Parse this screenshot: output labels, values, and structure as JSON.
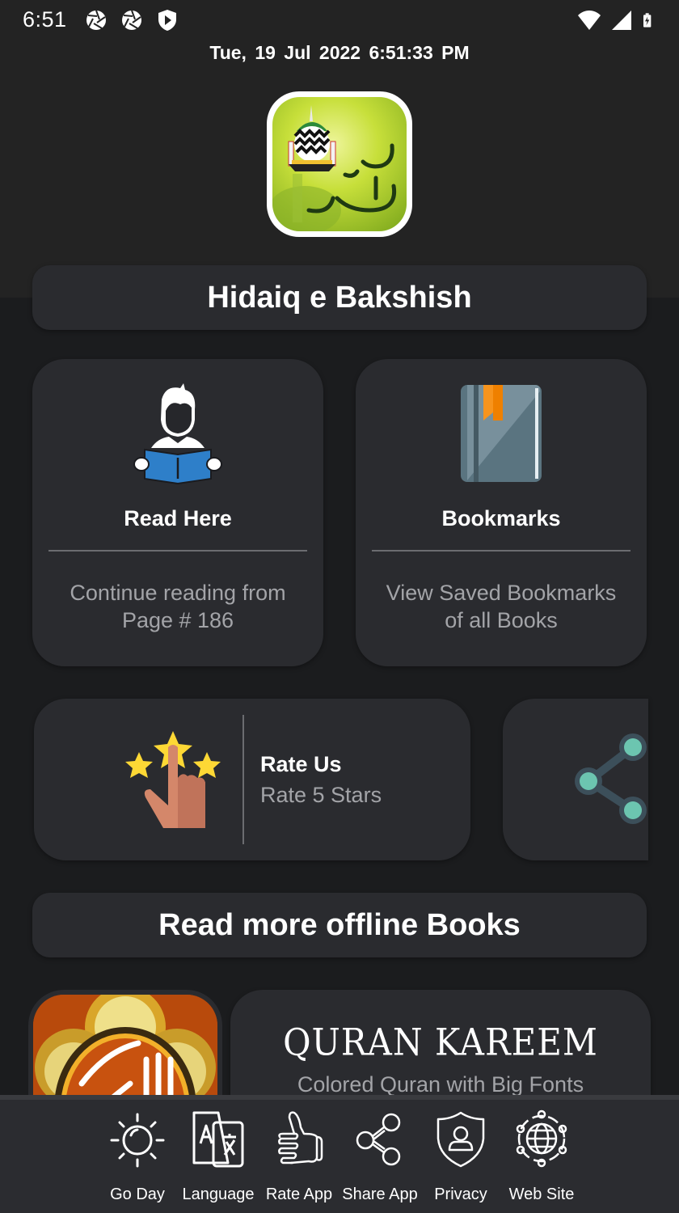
{
  "status_bar": {
    "time": "6:51",
    "left_icons": [
      "aperture-icon",
      "aperture-icon",
      "shield-play-icon"
    ],
    "right_icons": [
      "wifi-icon",
      "cellular-signal-icon",
      "battery-charging-icon"
    ]
  },
  "header": {
    "datetime": "Tue, 19  Jul  2022   6:51:33 PM",
    "app_logo": "hadaiq-e-bakhshish-logo",
    "app_title": "Hidaiq e Bakshish"
  },
  "features": [
    {
      "icon": "reader-icon",
      "title": "Read Here",
      "subtitle_line1": "Continue reading from",
      "subtitle_line2": "Page # 186"
    },
    {
      "icon": "bookmark-book-icon",
      "title": "Bookmarks",
      "subtitle_line1": "View Saved Bookmarks",
      "subtitle_line2": "of all Books"
    }
  ],
  "rate_card": {
    "icon": "rating-stars-icon",
    "title": "Rate Us",
    "subtitle": "Rate 5 Stars"
  },
  "share_card": {
    "icon": "share-icon"
  },
  "more_books": {
    "heading": "Read more offline Books",
    "items": [
      {
        "thumb": "quran-kareem-logo",
        "title": "QURAN  KAREEM",
        "subtitle": "Colored Quran with Big Fonts"
      }
    ]
  },
  "bottom_nav": {
    "items": [
      {
        "icon": "sun-icon",
        "label": "Go Day"
      },
      {
        "icon": "translate-icon",
        "label": "Language"
      },
      {
        "icon": "thumbs-up-icon",
        "label": "Rate App"
      },
      {
        "icon": "share-icon",
        "label": "Share App"
      },
      {
        "icon": "privacy-shield-icon",
        "label": "Privacy"
      },
      {
        "icon": "globe-network-icon",
        "label": "Web Site"
      }
    ]
  },
  "colors": {
    "background": "#1b1c1e",
    "header_band": "#232323",
    "card": "#2a2b2f",
    "subtext": "#a3a4a8",
    "book_blue": "#2e7fc9",
    "bookmark_orange": "#f7941d",
    "star_yellow": "#fdd835",
    "share_teal": "#6cc5b0"
  }
}
